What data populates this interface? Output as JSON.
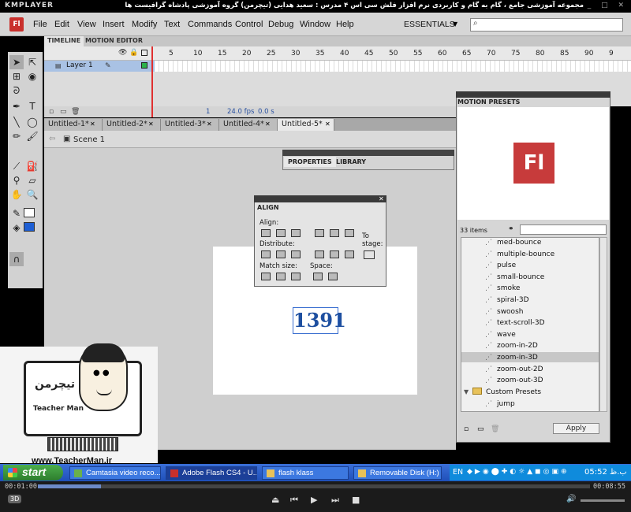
{
  "player": {
    "logo": "KMPLAYER",
    "caption": "مجموعه آموزشی جامع ، گام به گام و کاربردی نرم افزار فلش سی اس ۴ مدرس : سعید هدایی (تیچرمن) گروه آموزشی پادشاه گرافیست ها",
    "time_elapsed": "00:01:00",
    "time_total": "00:08:55",
    "badge_3d": "3D"
  },
  "app": {
    "icon_label": "Fl",
    "menu": [
      "File",
      "Edit",
      "View",
      "Insert",
      "Modify",
      "Text",
      "Commands",
      "Control",
      "Debug",
      "Window",
      "Help"
    ],
    "workspace": "ESSENTIALS",
    "search_placeholder": ""
  },
  "timeline": {
    "tabs": [
      "TIMELINE",
      "MOTION EDITOR"
    ],
    "frame_numbers": [
      "5",
      "10",
      "15",
      "20",
      "25",
      "30",
      "35",
      "40",
      "45",
      "50",
      "55",
      "60",
      "65",
      "70",
      "75",
      "80",
      "85",
      "90",
      "9"
    ],
    "layer_name": "Layer 1",
    "current_frame": "1",
    "fps": "24.0 fps",
    "elapsed": "0.0 s"
  },
  "documents": {
    "tabs": [
      "Untitled-1*",
      "Untitled-2*",
      "Untitled-3*",
      "Untitled-4*",
      "Untitled-5*"
    ],
    "scene": "Scene 1"
  },
  "stage": {
    "text": "1391"
  },
  "properties_panel": {
    "tabs": [
      "PROPERTIES",
      "LIBRARY"
    ]
  },
  "align_panel": {
    "tab": "ALIGN",
    "align_label": "Align:",
    "distribute_label": "Distribute:",
    "match_label": "Match size:",
    "space_label": "Space:",
    "to_stage_label": "To stage:"
  },
  "motion_presets": {
    "tab": "MOTION PRESETS",
    "preview_logo": "Fl",
    "items_count": "33 items",
    "items": [
      "med-bounce",
      "multiple-bounce",
      "pulse",
      "small-bounce",
      "smoke",
      "spiral-3D",
      "swoosh",
      "text-scroll-3D",
      "wave",
      "zoom-in-2D",
      "zoom-in-3D",
      "zoom-out-2D",
      "zoom-out-3D"
    ],
    "selected": "zoom-in-3D",
    "folder": "Custom Presets",
    "folder_items": [
      "jump"
    ],
    "apply_label": "Apply"
  },
  "branding": {
    "logo_text": "تیچرمن",
    "name": "Teacher Man",
    "url": "www.TeacherMan.ir"
  },
  "taskbar": {
    "start_label": "start",
    "tasks": [
      "Camtasia video reco...",
      "Adobe Flash CS4 - U...",
      "flash klass",
      "Removable Disk (H:)"
    ],
    "language": "EN",
    "clock": "05:52 ب.ظ"
  },
  "colors": {
    "flash_red": "#c9302c",
    "layer_selected": "#a9c2e4",
    "xp_taskbar": "#2a5cc8",
    "stage_text": "#1e4fa0"
  }
}
